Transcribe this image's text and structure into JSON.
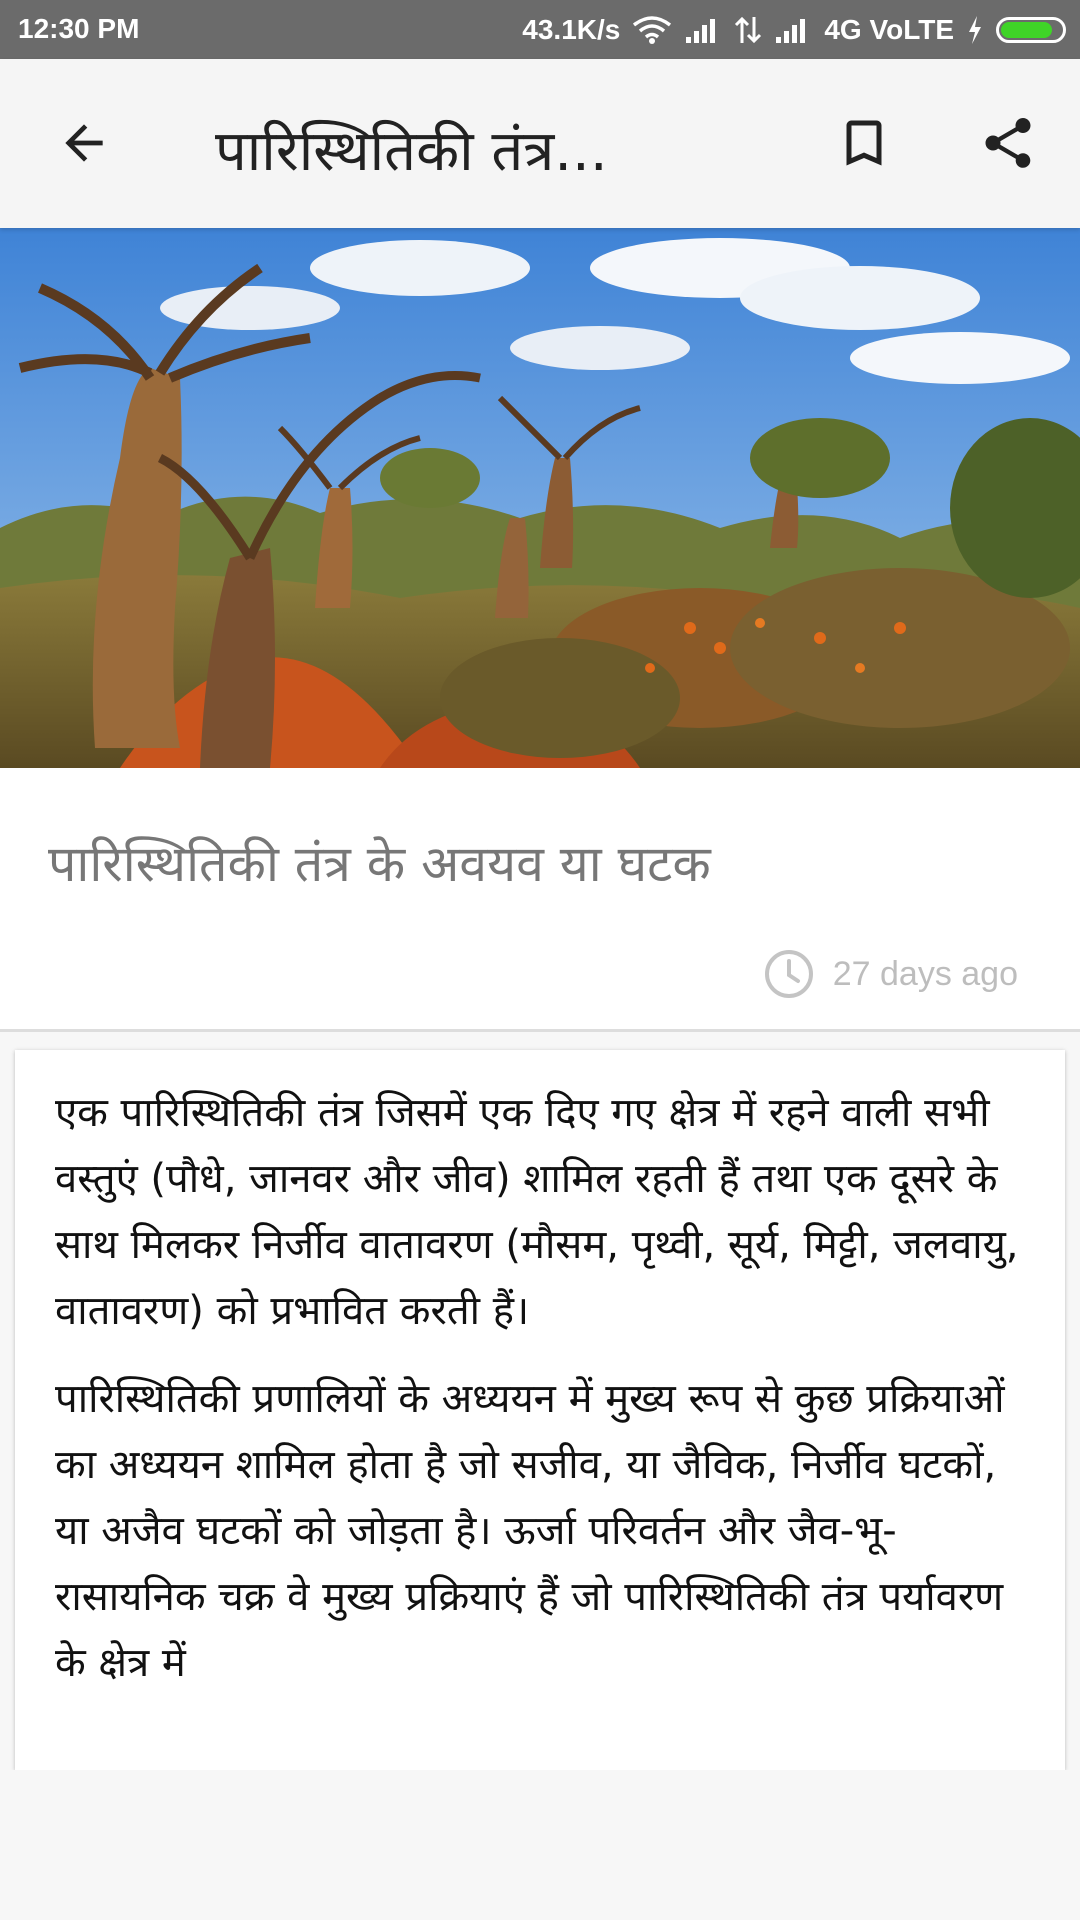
{
  "status_bar": {
    "time": "12:30 PM",
    "speed": "43.1K/s",
    "network": "4G VoLTE",
    "battery_level": 0.85,
    "battery_color": "#3fd427"
  },
  "app_bar": {
    "title": "पारिस्थितिकी तंत्र...",
    "back_icon": "arrow-back-icon",
    "bookmark_icon": "bookmark-icon",
    "share_icon": "share-icon"
  },
  "article": {
    "hero_image": "baobab-trees-landscape",
    "title": "पारिस्थितिकी तंत्र के अवयव या घटक",
    "time_ago": "27 days ago",
    "paragraphs": [
      "एक पारिस्थितिकी तंत्र जिसमें एक दिए गए क्षेत्र में रहने वाली सभी वस्तुएं (पौधे, जानवर और जीव) शामिल रहती हैं तथा एक दूसरे के साथ मिलकर निर्जीव वातावरण (मौसम, पृथ्वी, सूर्य, मिट्टी, जलवायु, वातावरण) को प्रभावित करती हैं।",
      "पारिस्थितिकी प्रणालियों के अध्ययन में मुख्य रूप से कुछ प्रक्रियाओं का अध्ययन शामिल होता है जो सजीव, या जैविक, निर्जीव घटकों, या अजैव घटकों को जोड़ता है। ऊर्जा परिवर्तन और जैव-भू-रासायनिक चक्र वे मुख्य प्रक्रियाएं हैं जो पारिस्थितिकी तंत्र पर्यावरण के क्षेत्र में"
    ]
  }
}
